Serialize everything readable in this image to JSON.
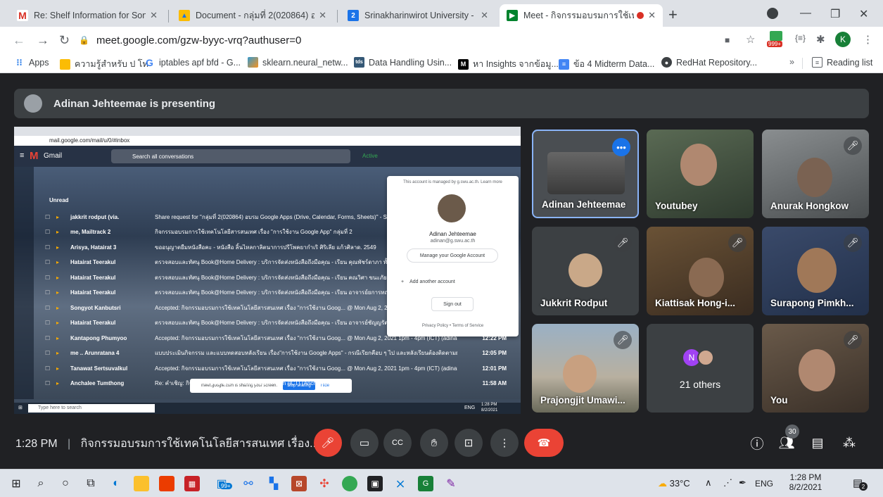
{
  "browser": {
    "tabs": [
      {
        "title": "Re: Shelf Information for Sonthi",
        "favicon": "M",
        "color": "#d93025"
      },
      {
        "title": "Document - กลุ่มที่ 2(020864) อบร",
        "favicon": "▲",
        "color": "#fbbc04"
      },
      {
        "title": "Srinakharinwirot University - Cale",
        "favicon": "2",
        "color": "#1a73e8"
      },
      {
        "title": "Meet - กิจกรรมอบรมการใช้เทคโน",
        "favicon": "▶",
        "color": "#00832d"
      }
    ],
    "url": "meet.google.com/gzw-byyc-vrq?authuser=0",
    "extension_badge": "999+",
    "profile_initial": "K",
    "bookmarks": [
      {
        "label": "Apps",
        "icon": "apps-icon"
      },
      {
        "label": "ความรู้สำหรับ ป โท",
        "icon": "folder-icon"
      },
      {
        "label": "iptables apf bfd - G...",
        "icon": "google-icon"
      },
      {
        "label": "sklearn.neural_netw...",
        "icon": "sklearn-icon"
      },
      {
        "label": "Data Handling Usin...",
        "icon": "tds-icon"
      },
      {
        "label": "หา Insights จากข้อมู...",
        "icon": "medium-icon"
      },
      {
        "label": "ข้อ 4 Midterm Data...",
        "icon": "docs-icon"
      },
      {
        "label": "RedHat Repository...",
        "icon": "github-icon"
      }
    ],
    "more_bookmarks": "»",
    "reading_list": "Reading list"
  },
  "meet": {
    "presenting_text": "Adinan Jehteemae is presenting",
    "participants": [
      {
        "name": "Adinan Jehteemae",
        "muted": false
      },
      {
        "name": "Youtubey",
        "muted": false
      },
      {
        "name": "Anurak Hongkow",
        "muted": true
      },
      {
        "name": "Jukkrit Rodput",
        "muted": true
      },
      {
        "name": "Kiattisak Hong-i...",
        "muted": true
      },
      {
        "name": "Surapong Pimkh...",
        "muted": true
      },
      {
        "name": "Prajongjit Umawi...",
        "muted": true
      },
      {
        "name": "21 others",
        "muted": false
      },
      {
        "name": "You",
        "muted": true
      }
    ],
    "others_initial": "N",
    "time": "1:28 PM",
    "meeting_title": "กิจกรรมอบรมการใช้เทคโนโลยีสารสนเทศ เรื่อง...",
    "participants_count": "30"
  },
  "shared_screen": {
    "url": "mail.google.com/mail/u/0/#inbox",
    "app_name": "Gmail",
    "search_placeholder": "Search all conversations",
    "status": "Active",
    "section": "Unread",
    "emails": [
      {
        "sender": "jakkrit rodput (via.",
        "subject": "Share request for \"กลุ่มที่ 2(020864) อบรม Google Apps (Drive, Calendar, Forms, Sheets)\" - Share",
        "time": ""
      },
      {
        "sender": "me, Mailtrack 2",
        "subject": "กิจกรรมอบรมการใช้เทคโนโลยีสารสนเทศ เรื่อง \"การใช้งาน Google App\" กลุ่มที่ 2",
        "time": ""
      },
      {
        "sender": "Arisya, Hatairat 3",
        "subject": "ขออนุญาตยืมหนังสือคะ - หนังสือ ลิ้นไหลกาลิตนาการปรีโพคยากำเริ ศิริเลีย แก้วศิลาด. 2549",
        "time": ""
      },
      {
        "sender": "Hatairat Teerakul",
        "subject": "ตรวจสอบและทัศนุ Book@Home Delivery : บริการจัดส่งหนังสือถึงมือคุณ - เรียน คุณพัชร์ดาภา ทั้งทรัพ",
        "time": ""
      },
      {
        "sender": "Hatairat Teerakul",
        "subject": "ตรวจสอบและทัศนุ Book@Home Delivery : บริการจัดส่งหนังสือถึงมือคุณ - เรียน คณวิศา ขนะภัย ตรวจ",
        "time": ""
      },
      {
        "sender": "Hatairat Teerakul",
        "subject": "ตรวจสอบและทัศนุ Book@Home Delivery : บริการจัดส่งหนังสือถึงมือคุณ - เรียน อาจารย์ยการทณ เรียม",
        "time": ""
      },
      {
        "sender": "Songyot Kanbutsri",
        "subject": "Accepted: กิจกรรมอบรมการใช้เทคโนโลยีสารสนเทศ เรื่อง \"การใช้งาน Goog... @ Mon Aug 2, 2021",
        "time": ""
      },
      {
        "sender": "Hatairat Teerakul",
        "subject": "ตรวจสอบและทัศนุ Book@Home Delivery : บริการจัดส่งหนังสือถึงมือคุณ - เรียน อาจารย์ชัญญรัตน์ ประ",
        "time": ""
      },
      {
        "sender": "Kantapong Phumyoo",
        "subject": "Accepted: กิจกรรมอบรมการใช้เทคโนโลยีสารสนเทศ เรื่อง \"การใช้งาน Goog... @ Mon Aug 2, 2021 1pm - 4pm (ICT) (adinan@g.swu...",
        "time": "12:22 PM"
      },
      {
        "sender": "me .. Arunratana 4",
        "subject": "แบบประเมินกิจกรรม และแบบทดสอบหลังเรียน เรื่อง\"การใช้งาน Google Apps\" - กรณีเรียกคือบ ๆ ไป และหลังเรียนต้องติดตามผล ก็มีทีดอยู่แล้ว...",
        "time": "12:05 PM"
      },
      {
        "sender": "Tanawat Sertsuvalkul",
        "subject": "Accepted: กิจกรรมอบรมการใช้เทคโนโลยีสารสนเทศ เรื่อง \"การใช้งาน Goog... @ Mon Aug 2, 2021 1pm - 4pm (ICT) (adinan@g.swu...",
        "time": "12:01 PM"
      },
      {
        "sender": "Anchalee Tumthong",
        "subject": "Re: คำเชิญ: กิจกร ... ในวัน จ. 2 ส.ค. 2021 1pm - 4pm (ICT) (Anchalee Tu...",
        "time": "11:58 AM"
      }
    ],
    "account_popup": {
      "managed_text": "This account is managed by g.swu.ac.th. Learn more",
      "name": "Adinan Jehteemae",
      "email": "adinan@g.swu.ac.th",
      "manage": "Manage your Google Account",
      "add": "Add another account",
      "signout": "Sign out",
      "footer": "Privacy Policy • Terms of Service"
    },
    "sharing_bar": {
      "text": "meet.google.com is sharing your screen.",
      "stop": "Stop sharing",
      "hide": "Hide"
    },
    "inner_taskbar": {
      "search": "Type here to search",
      "time": "1:28 PM",
      "date": "8/2/2021",
      "lang": "ENG"
    }
  },
  "taskbar": {
    "search_icon": "search-icon",
    "temperature": "33°C",
    "language": "ENG",
    "time": "1:28 PM",
    "date": "8/2/2021",
    "store_badge": "99+",
    "notification_count": "2"
  }
}
